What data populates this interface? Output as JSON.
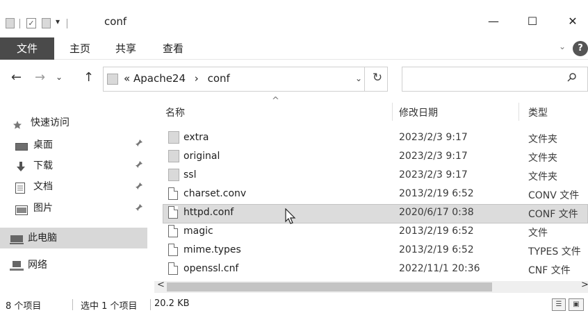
{
  "window": {
    "title": "conf",
    "minimize": "—",
    "maximize": "☐",
    "close": "✕"
  },
  "ribbon": {
    "tabs": [
      "文件",
      "主页",
      "共享",
      "查看"
    ],
    "expand": "⌄",
    "help": "?"
  },
  "address": {
    "overflow": "«",
    "path": [
      "Apache24",
      "conf"
    ],
    "separator": "›",
    "dropdown": "⌄",
    "refresh": "↻",
    "search_placeholder": ""
  },
  "nav_buttons": {
    "back": "←",
    "forward": "→",
    "recent": "⌄",
    "up": "↑"
  },
  "sidebar": {
    "quick_access": "快速访问",
    "items": [
      {
        "label": "桌面",
        "icon": "desktop-icon",
        "pinned": true
      },
      {
        "label": "下载",
        "icon": "download-icon",
        "pinned": true
      },
      {
        "label": "文档",
        "icon": "document-icon",
        "pinned": true
      },
      {
        "label": "图片",
        "icon": "pictures-icon",
        "pinned": true
      }
    ],
    "this_pc": "此电脑",
    "network": "网络",
    "pin_glyph": "📌"
  },
  "columns": {
    "name": "名称",
    "modified": "修改日期",
    "type": "类型",
    "sort_glyph": "^"
  },
  "files": [
    {
      "name": "extra",
      "modified": "2023/2/3 9:17",
      "type": "文件夹",
      "kind": "folder"
    },
    {
      "name": "original",
      "modified": "2023/2/3 9:17",
      "type": "文件夹",
      "kind": "folder"
    },
    {
      "name": "ssl",
      "modified": "2023/2/3 9:17",
      "type": "文件夹",
      "kind": "folder"
    },
    {
      "name": "charset.conv",
      "modified": "2013/2/19 6:52",
      "type": "CONV 文件",
      "kind": "file"
    },
    {
      "name": "httpd.conf",
      "modified": "2020/6/17 0:38",
      "type": "CONF 文件",
      "kind": "file",
      "selected": true
    },
    {
      "name": "magic",
      "modified": "2013/2/19 6:52",
      "type": "文件",
      "kind": "file"
    },
    {
      "name": "mime.types",
      "modified": "2013/2/19 6:52",
      "type": "TYPES 文件",
      "kind": "file"
    },
    {
      "name": "openssl.cnf",
      "modified": "2022/11/1 20:36",
      "type": "CNF 文件",
      "kind": "file"
    }
  ],
  "scrollbar": {
    "left": "<",
    "right": ">"
  },
  "status": {
    "count": "8 个项目",
    "selected": "选中 1 个项目",
    "size": "20.2 KB"
  },
  "colors": {
    "file_tab_bg": "#4a4a4a",
    "selection_bg": "#dcdcdc",
    "nav_selected": "#d8d8d8"
  }
}
